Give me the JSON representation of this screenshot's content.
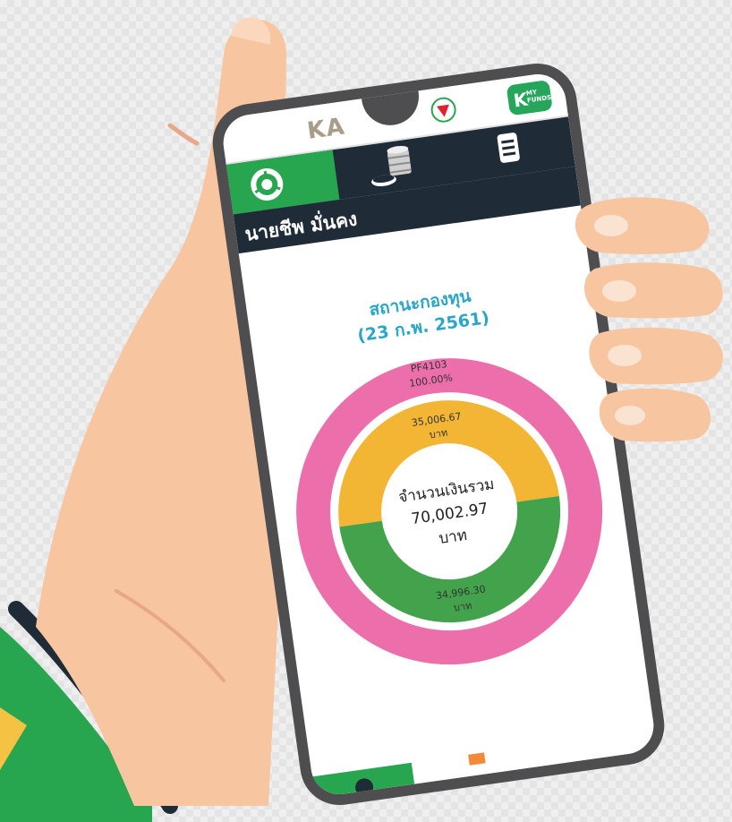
{
  "app": {
    "brand_text": "KA",
    "kmf_badge": {
      "letter": "K",
      "line1": "MY",
      "line2": "FUNDS"
    }
  },
  "nav": {
    "tabs": [
      {
        "name": "home",
        "icon": "donut-chart-icon",
        "active": true
      },
      {
        "name": "funds",
        "icon": "coins-stack-icon",
        "active": false
      },
      {
        "name": "menu",
        "icon": "hamburger-menu-icon",
        "active": false
      }
    ]
  },
  "member": {
    "name": "นายชีพ มั่นคง"
  },
  "status": {
    "title": "สถานะกองทุน",
    "date": "(23 ก.พ. 2561)"
  },
  "colors": {
    "nav_dark": "#1f2b36",
    "accent_green": "#27a54f",
    "fund_ring": "#ec6fab",
    "contribution_yellow": "#f3b634",
    "contribution_green": "#43a24c",
    "title_blue": "#2aa6c8"
  },
  "chart_data": {
    "type": "pie",
    "center": {
      "label": "จำนวนเงินรวม",
      "value": "70,002.97",
      "unit": "บาท"
    },
    "outer_ring": [
      {
        "label": "PF4103",
        "percent_label": "100.00%",
        "value": 100.0
      }
    ],
    "inner_ring": [
      {
        "value": 35006.67,
        "label": "35,006.67",
        "unit": "บาท"
      },
      {
        "value": 34996.3,
        "label": "34,996.30",
        "unit": "บาท"
      }
    ]
  }
}
